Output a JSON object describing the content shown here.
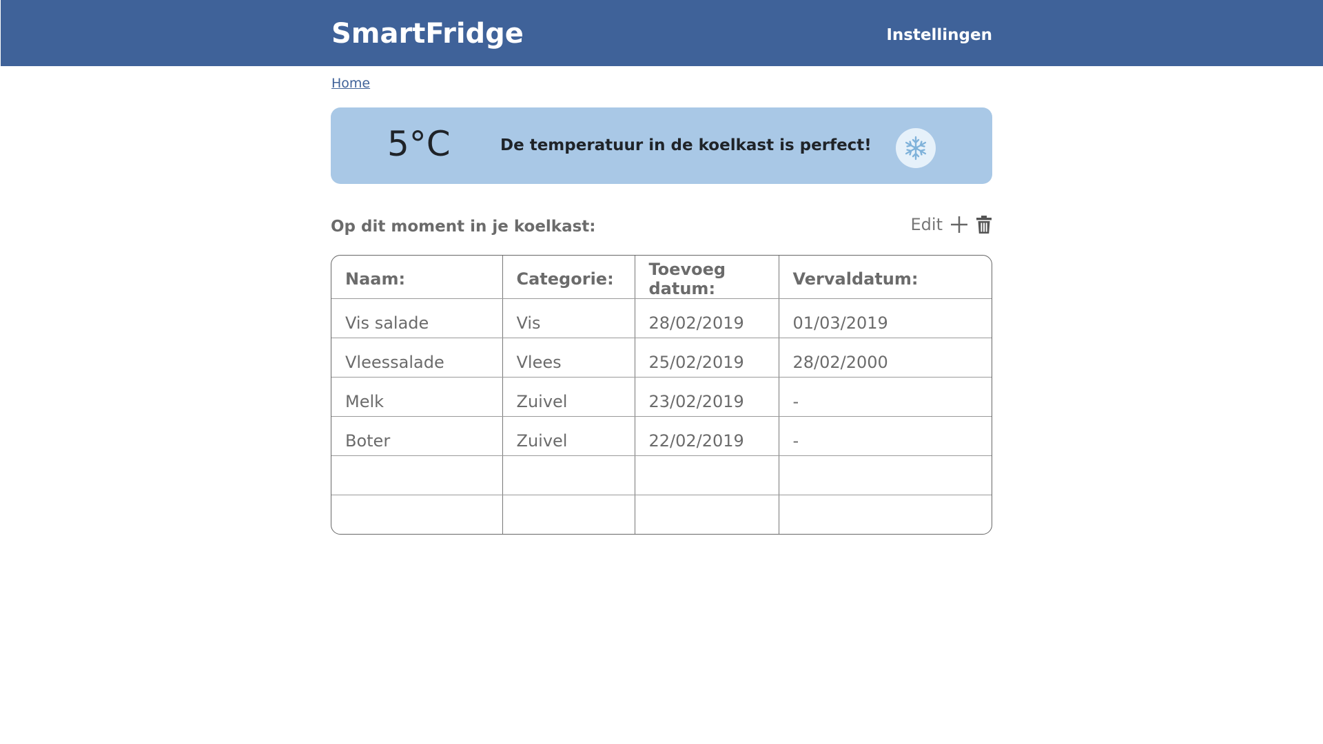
{
  "header": {
    "brand": "SmartFridge",
    "settings_label": "Instellingen"
  },
  "breadcrumb": {
    "home_label": "Home "
  },
  "temperature": {
    "value": "5°C",
    "message": "De temperatuur in de koelkast is perfect!",
    "icon": "snowflake-icon"
  },
  "inventory": {
    "title": "Op dit moment in je koelkast:",
    "edit_label": "Edit",
    "add_icon": "plus-icon",
    "delete_icon": "trash-icon",
    "columns": [
      "Naam:",
      "Categorie:",
      "Toevoeg datum:",
      "Vervaldatum:"
    ],
    "rows": [
      [
        "Vis salade",
        "Vis",
        "28/02/2019",
        "01/03/2019"
      ],
      [
        "Vleessalade",
        "Vlees",
        "25/02/2019",
        "28/02/2000"
      ],
      [
        "Melk",
        " Zuivel",
        " 23/02/2019",
        " -"
      ],
      [
        "Boter",
        " Zuivel",
        " 22/02/2019",
        " -"
      ],
      [
        "",
        "",
        "",
        ""
      ],
      [
        "",
        "",
        "",
        ""
      ]
    ]
  },
  "colors": {
    "header_bg": "#3f6299",
    "temp_card_bg": "#a9c8e6",
    "text_muted": "#6b6b6b"
  }
}
